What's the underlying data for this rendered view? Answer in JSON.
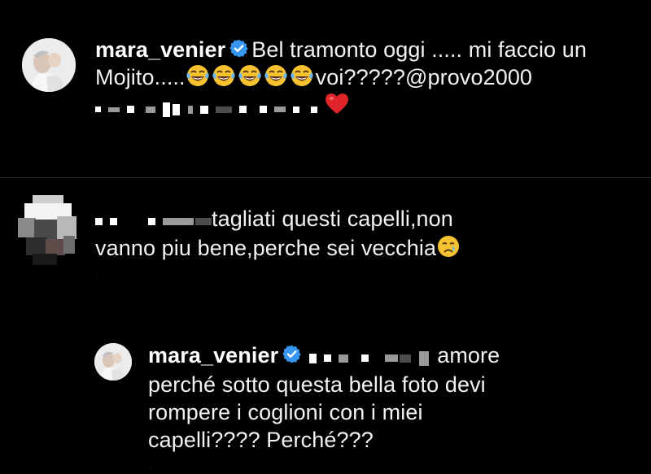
{
  "post_comment": {
    "username": "mara_venier",
    "verified_icon": "verified-badge-icon",
    "text_part1": "Bel tramonto oggi ..... mi faccio un",
    "text_line2_start": "Mojito.....",
    "emoji_count": 5,
    "emoji_name": "face-with-tears-of-joy",
    "text_line2_end": "voi?????@provo2000",
    "heart_icon": "red-heart-emoji",
    "colors": {
      "verified": "#3797f0",
      "heart": "#e0242a"
    }
  },
  "comment": {
    "text_line1": "tagliati questi capelli,non",
    "text_line2": "vanno piu bene,perche sei vecchia",
    "emoji_name": "crying-face"
  },
  "reply": {
    "username": "mara_venier",
    "verified_icon": "verified-badge-icon",
    "text_line1_end": "amore",
    "text_line2": "perché sotto questa bella foto devi",
    "text_line3": "rompere i coglioni con i miei",
    "text_line4": "capelli???? Perché???"
  }
}
